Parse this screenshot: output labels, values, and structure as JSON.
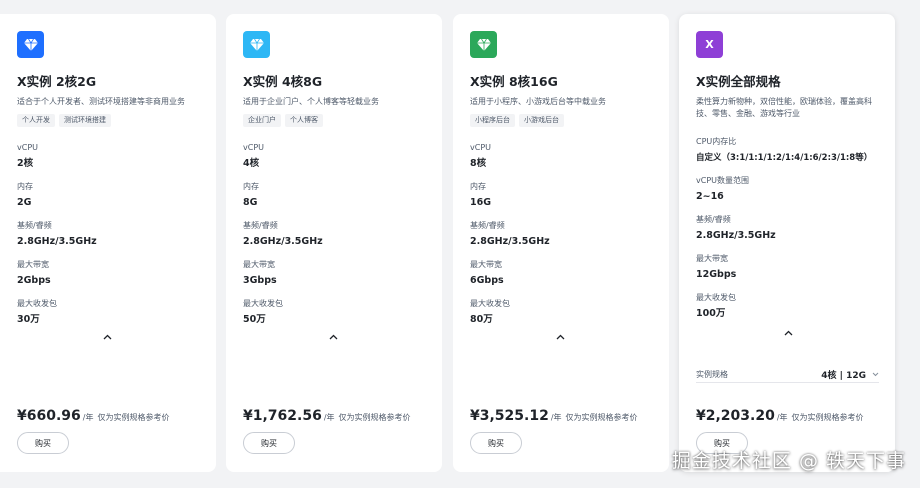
{
  "colors": {
    "page_bg": "#f2f3f5",
    "card_bg": "#ffffff",
    "text_primary": "#1f2329",
    "text_secondary": "#4e5969",
    "logo_blue": "#1e6fff",
    "logo_cyan": "#2db7f5",
    "logo_green": "#2ba85a",
    "logo_purple": "#8e3fd6"
  },
  "cards": [
    {
      "logo_icon": "diamond-icon",
      "title": "X实例 2核2G",
      "desc": [
        "适合于个人开发者、测试环境搭建等非商用业务"
      ],
      "tags": [
        "个人开发",
        "测试环境搭建"
      ],
      "specs": [
        {
          "label": "vCPU",
          "value": "2核"
        },
        {
          "label": "内存",
          "value": "2G"
        },
        {
          "label": "基频/睿频",
          "value": "2.8GHz/3.5GHz"
        },
        {
          "label": "最大带宽",
          "value": "2Gbps"
        },
        {
          "label": "最大收发包",
          "value": "30万"
        }
      ],
      "price": "¥660.96",
      "unit": "/年",
      "note": "仅为实例规格参考价",
      "buy_label": "购买"
    },
    {
      "logo_icon": "diamond-icon",
      "title": "X实例 4核8G",
      "desc": [
        "适用于企业门户、个人博客等轻载业务"
      ],
      "tags": [
        "企业门户",
        "个人博客"
      ],
      "specs": [
        {
          "label": "vCPU",
          "value": "4核"
        },
        {
          "label": "内存",
          "value": "8G"
        },
        {
          "label": "基频/睿频",
          "value": "2.8GHz/3.5GHz"
        },
        {
          "label": "最大带宽",
          "value": "3Gbps"
        },
        {
          "label": "最大收发包",
          "value": "50万"
        }
      ],
      "price": "¥1,762.56",
      "unit": "/年",
      "note": "仅为实例规格参考价",
      "buy_label": "购买"
    },
    {
      "logo_icon": "diamond-icon",
      "title": "X实例 8核16G",
      "desc": [
        "适用于小程序、小游戏后台等中载业务"
      ],
      "tags": [
        "小程序后台",
        "小游戏后台"
      ],
      "specs": [
        {
          "label": "vCPU",
          "value": "8核"
        },
        {
          "label": "内存",
          "value": "16G"
        },
        {
          "label": "基频/睿频",
          "value": "2.8GHz/3.5GHz"
        },
        {
          "label": "最大带宽",
          "value": "6Gbps"
        },
        {
          "label": "最大收发包",
          "value": "80万"
        }
      ],
      "price": "¥3,525.12",
      "unit": "/年",
      "note": "仅为实例规格参考价",
      "buy_label": "购买"
    },
    {
      "logo_icon": "x-letter-icon",
      "logo_text": "X",
      "title": "X实例全部规格",
      "desc": [
        "柔性算力新物种，双倍性能，欧瑞体验，覆盖高科",
        "技、零售、金融、游戏等行业"
      ],
      "specs": [
        {
          "label": "CPU内存比",
          "value": "自定义（3:1/1:1/1:2/1:4/1:6/2:3/1:8等）"
        },
        {
          "label": "vCPU数量范围",
          "value": "2~16"
        },
        {
          "label": "基频/睿频",
          "value": "2.8GHz/3.5GHz"
        },
        {
          "label": "最大带宽",
          "value": "12Gbps"
        },
        {
          "label": "最大收发包",
          "value": "100万"
        }
      ],
      "spec_select": {
        "label": "实例规格",
        "value": "4核 | 12G"
      },
      "price": "¥2,203.20",
      "unit": "/年",
      "note": "仅为实例规格参考价",
      "buy_label": "购买"
    }
  ],
  "watermark": "掘金技术社区 @ 轶天下事"
}
